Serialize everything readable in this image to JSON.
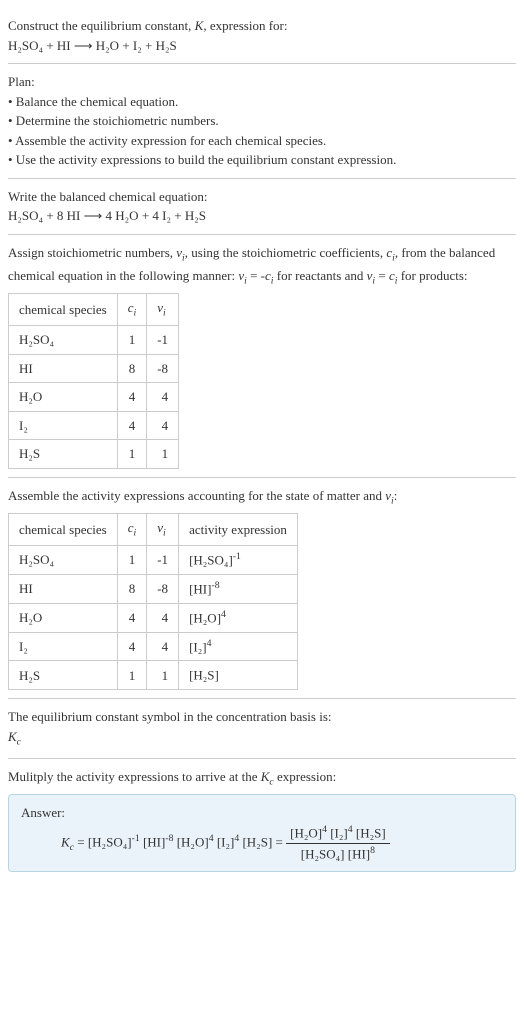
{
  "intro": {
    "line1": "Construct the equilibrium constant, ",
    "k": "K",
    "line1b": ", expression for:",
    "eq": "H₂SO₄ + HI ⟶ H₂O + I₂ + H₂S"
  },
  "plan": {
    "title": "Plan:",
    "b1": "• Balance the chemical equation.",
    "b2": "• Determine the stoichiometric numbers.",
    "b3": "• Assemble the activity expression for each chemical species.",
    "b4": "• Use the activity expressions to build the equilibrium constant expression."
  },
  "balanced": {
    "title": "Write the balanced chemical equation:",
    "eq": "H₂SO₄ + 8 HI ⟶ 4 H₂O + 4 I₂ + H₂S"
  },
  "assign": {
    "text1": "Assign stoichiometric numbers, ",
    "nu": "ν",
    "isub": "i",
    "text2": ", using the stoichiometric coefficients, ",
    "c": "c",
    "text3": ", from the balanced chemical equation in the following manner: ",
    "text4": " = -",
    "text5": " for reactants and ",
    "text6": " = ",
    "text7": " for products:"
  },
  "table1": {
    "h1": "chemical species",
    "h2c": "c",
    "h2i": "i",
    "h3n": "ν",
    "h3i": "i",
    "rows": [
      {
        "sp": "H₂SO₄",
        "c": "1",
        "n": "-1"
      },
      {
        "sp": "HI",
        "c": "8",
        "n": "-8"
      },
      {
        "sp": "H₂O",
        "c": "4",
        "n": "4"
      },
      {
        "sp": "I₂",
        "c": "4",
        "n": "4"
      },
      {
        "sp": "H₂S",
        "c": "1",
        "n": "1"
      }
    ]
  },
  "assemble": {
    "text1": "Assemble the activity expressions accounting for the state of matter and ",
    "nu": "ν",
    "isub": "i",
    "colon": ":"
  },
  "table2": {
    "h1": "chemical species",
    "h2c": "c",
    "h2i": "i",
    "h3n": "ν",
    "h3i": "i",
    "h4": "activity expression",
    "rows": [
      {
        "sp": "H₂SO₄",
        "c": "1",
        "n": "-1",
        "aebase": "[H₂SO₄]",
        "aeexp": "-1"
      },
      {
        "sp": "HI",
        "c": "8",
        "n": "-8",
        "aebase": "[HI]",
        "aeexp": "-8"
      },
      {
        "sp": "H₂O",
        "c": "4",
        "n": "4",
        "aebase": "[H₂O]",
        "aeexp": "4"
      },
      {
        "sp": "I₂",
        "c": "4",
        "n": "4",
        "aebase": "[I₂]",
        "aeexp": "4"
      },
      {
        "sp": "H₂S",
        "c": "1",
        "n": "1",
        "aebase": "[H₂S]",
        "aeexp": ""
      }
    ]
  },
  "symbol": {
    "text": "The equilibrium constant symbol in the concentration basis is:",
    "k": "K",
    "csub": "c"
  },
  "multiply": {
    "text1": "Mulitply the activity expressions to arrive at the ",
    "k": "K",
    "csub": "c",
    "text2": " expression:"
  },
  "answer": {
    "label": "Answer:",
    "kc_k": "K",
    "kc_c": "c",
    "eq": " = ",
    "t1": "[H₂SO₄]",
    "e1": "-1",
    "t2": " [HI]",
    "e2": "-8",
    "t3": " [H₂O]",
    "e3": "4",
    "t4": " [I₂]",
    "e4": "4",
    "t5": " [H₂S] = ",
    "num1": "[H₂O]",
    "nume1": "4",
    "num2": " [I₂]",
    "nume2": "4",
    "num3": " [H₂S]",
    "den1": "[H₂SO₄] [HI]",
    "dene1": "8"
  }
}
